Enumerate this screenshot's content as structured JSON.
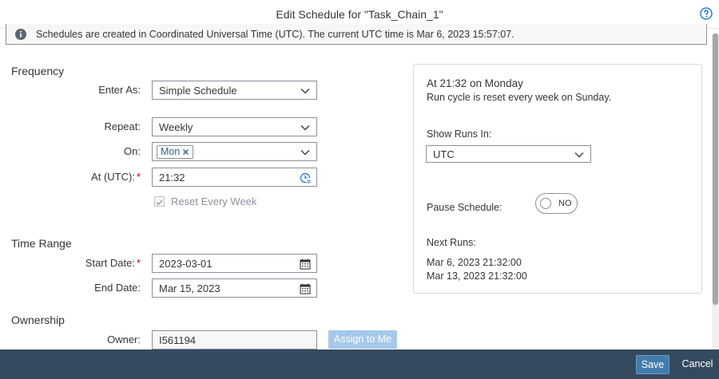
{
  "dialog": {
    "title": "Edit Schedule for \"Task_Chain_1\"",
    "info": "Schedules are created in Coordinated Universal Time (UTC). The current UTC time is Mar 6, 2023 15:57:07."
  },
  "frequency": {
    "section_title": "Frequency",
    "enter_as_label": "Enter As:",
    "enter_as_value": "Simple Schedule",
    "repeat_label": "Repeat:",
    "repeat_value": "Weekly",
    "on_label": "On:",
    "on_token": "Mon",
    "at_label": "At (UTC):",
    "at_value": "21:32",
    "reset_label": "Reset Every Week",
    "reset_checked": true
  },
  "time_range": {
    "section_title": "Time Range",
    "start_label": "Start Date:",
    "start_value": "2023-03-01",
    "end_label": "End Date:",
    "end_value": "Mar 15, 2023"
  },
  "ownership": {
    "section_title": "Ownership",
    "owner_label": "Owner:",
    "owner_value": "I561194",
    "assign_label": "Assign to Me"
  },
  "summary": {
    "heading": "At 21:32 on Monday",
    "subtext": "Run cycle is reset every week on Sunday.",
    "show_runs_label": "Show Runs In:",
    "show_runs_value": "UTC",
    "pause_label": "Pause Schedule:",
    "pause_state": "NO",
    "next_runs_label": "Next Runs:",
    "next_runs": [
      "Mar 6, 2023 21:32:00",
      "Mar 13, 2023 21:32:00"
    ]
  },
  "footer": {
    "save_label": "Save",
    "cancel_label": "Cancel"
  },
  "colors": {
    "footer_bg": "#354a5f",
    "primary_button": "#427cac",
    "disabled_button": "#a6c8ea",
    "required": "#bb0000"
  }
}
